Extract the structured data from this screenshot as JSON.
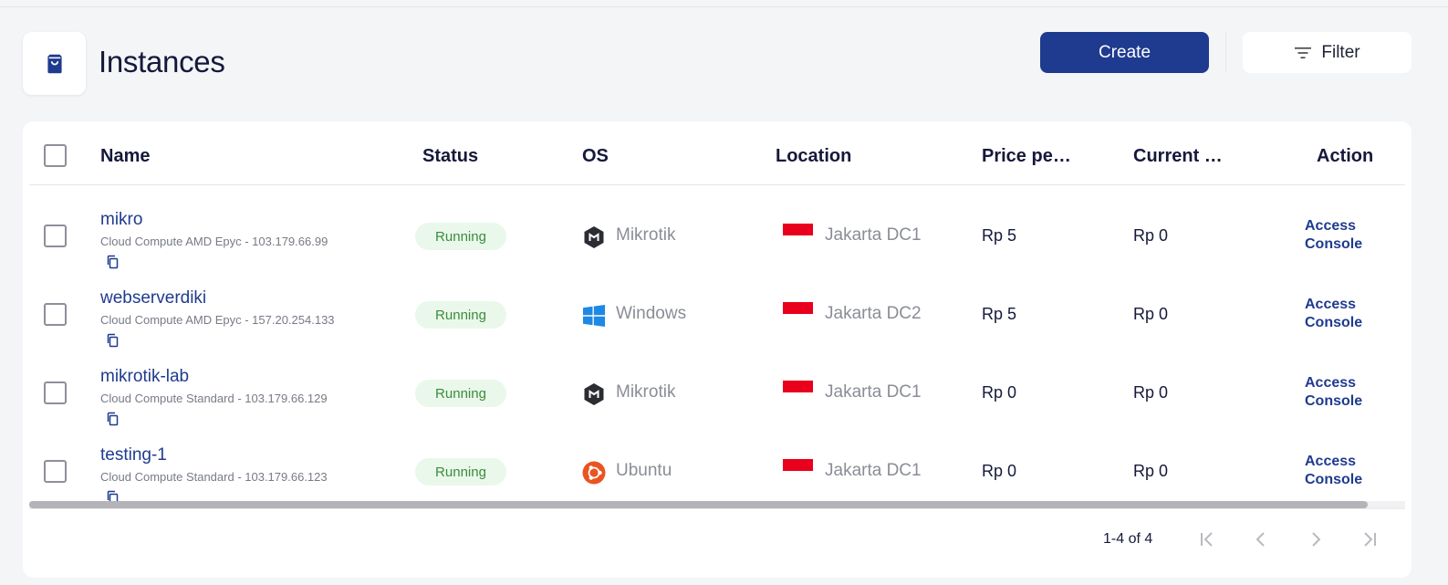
{
  "page": {
    "title": "Instances",
    "icon": "shopping-bag-icon"
  },
  "toolbar": {
    "create_label": "Create",
    "filter_label": "Filter",
    "filter_icon": "filter-lines-icon"
  },
  "table": {
    "columns": [
      "Name",
      "Status",
      "OS",
      "Location",
      "Price pe…",
      "Current …",
      "Action"
    ],
    "rows": [
      {
        "name": "mikro",
        "subtitle": "Cloud Compute AMD Epyc - 103.179.66.99",
        "status": "Running",
        "os": "Mikrotik",
        "os_icon": "mikrotik-icon",
        "location": "Jakarta DC1",
        "flag": "indonesia-flag",
        "price": "Rp 5",
        "current": "Rp 0",
        "action_line1": "Access",
        "action_line2": "Console"
      },
      {
        "name": "webserverdiki",
        "subtitle": "Cloud Compute AMD Epyc - 157.20.254.133",
        "status": "Running",
        "os": "Windows",
        "os_icon": "windows-icon",
        "location": "Jakarta DC2",
        "flag": "indonesia-flag",
        "price": "Rp 5",
        "current": "Rp 0",
        "action_line1": "Access",
        "action_line2": "Console"
      },
      {
        "name": "mikrotik-lab",
        "subtitle": "Cloud Compute Standard - 103.179.66.129",
        "status": "Running",
        "os": "Mikrotik",
        "os_icon": "mikrotik-icon",
        "location": "Jakarta DC1",
        "flag": "indonesia-flag",
        "price": "Rp 0",
        "current": "Rp 0",
        "action_line1": "Access",
        "action_line2": "Console"
      },
      {
        "name": "testing-1",
        "subtitle": "Cloud Compute Standard - 103.179.66.123",
        "status": "Running",
        "os": "Ubuntu",
        "os_icon": "ubuntu-icon",
        "location": "Jakarta DC1",
        "flag": "indonesia-flag",
        "price": "Rp 0",
        "current": "Rp 0",
        "action_line1": "Access",
        "action_line2": "Console"
      }
    ]
  },
  "pagination": {
    "range_text": "1-4 of 4"
  },
  "colors": {
    "primary": "#1f3b8f",
    "status_bg": "#e9f8ea",
    "status_text": "#3c8b3f",
    "flag_red": "#e8001c",
    "ubuntu": "#e95420"
  }
}
